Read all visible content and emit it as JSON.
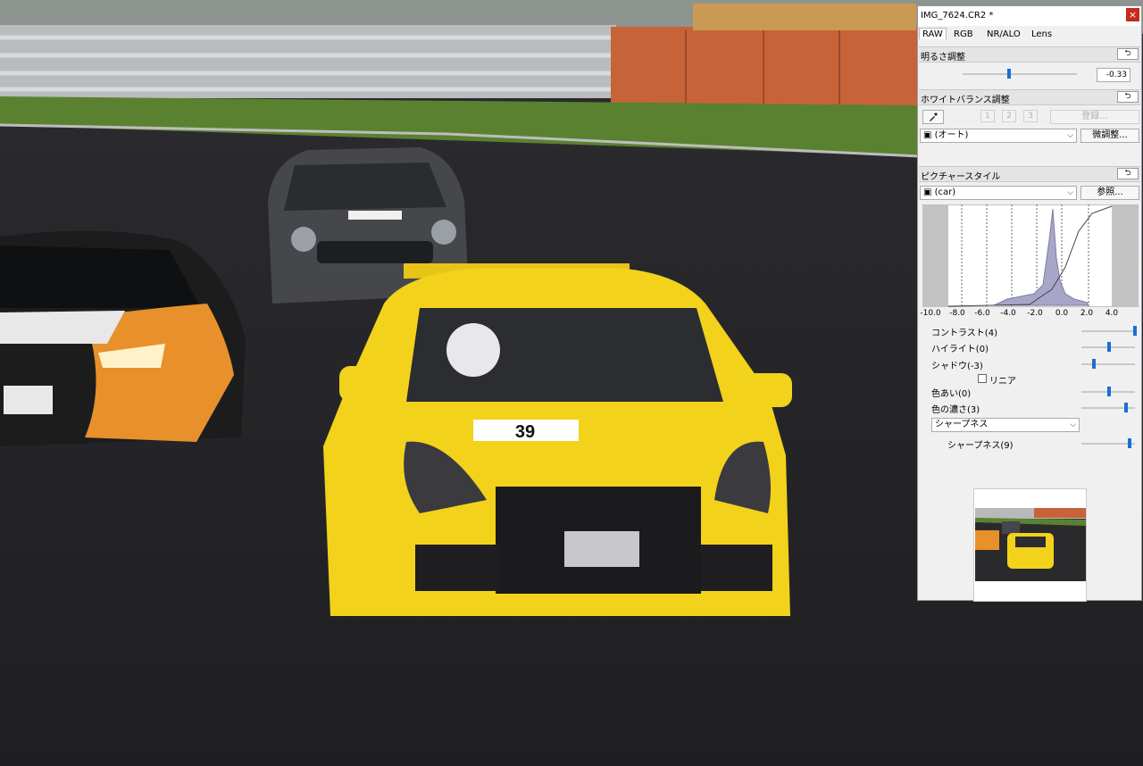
{
  "window": {
    "title": "IMG_7624.CR2 *",
    "close_glyph": "×"
  },
  "tabs": [
    {
      "label": "RAW",
      "active": true
    },
    {
      "label": "RGB",
      "active": false
    },
    {
      "label": "NR/ALO",
      "active": false
    },
    {
      "label": "Lens",
      "active": false
    }
  ],
  "brightness": {
    "header": "明るさ調整",
    "value": "-0.33",
    "slider_fraction": 0.41
  },
  "white_balance": {
    "header": "ホワイトバランス調整",
    "eyedropper_icon": "eyedropper-icon",
    "presets": [
      "1",
      "2",
      "3"
    ],
    "register_label": "登録...",
    "mode_value": "(オート)",
    "fine_tune_label": "微調整..."
  },
  "picture_style": {
    "header": "ピクチャースタイル",
    "style_value": "(car)",
    "browse_label": "参照...",
    "histogram_axis": [
      "-10.0",
      "-8.0",
      "-6.0",
      "-4.0",
      "-2.0",
      "0.0",
      "2.0",
      "4.0"
    ],
    "params": [
      {
        "label": "コントラスト(4)",
        "fraction": 1.0
      },
      {
        "label": "ハイライト(0)",
        "fraction": 0.5
      },
      {
        "label": "シャドウ(-3)",
        "fraction": 0.2
      }
    ],
    "linear_label": "リニア",
    "linear_checked": false,
    "color_params": [
      {
        "label": "色あい(0)",
        "fraction": 0.5
      },
      {
        "label": "色の濃さ(3)",
        "fraction": 0.83
      }
    ],
    "sharpness_mode": "シャープネス",
    "sharpness_param": {
      "label": "シャープネス(9)",
      "fraction": 0.9
    }
  },
  "reset_glyph": "⮌",
  "colors": {
    "accent": "#1a6fd1",
    "close_red": "#c42b1c",
    "car_yellow": "#f2d21b",
    "track_asphalt": "#2a2a2c"
  }
}
